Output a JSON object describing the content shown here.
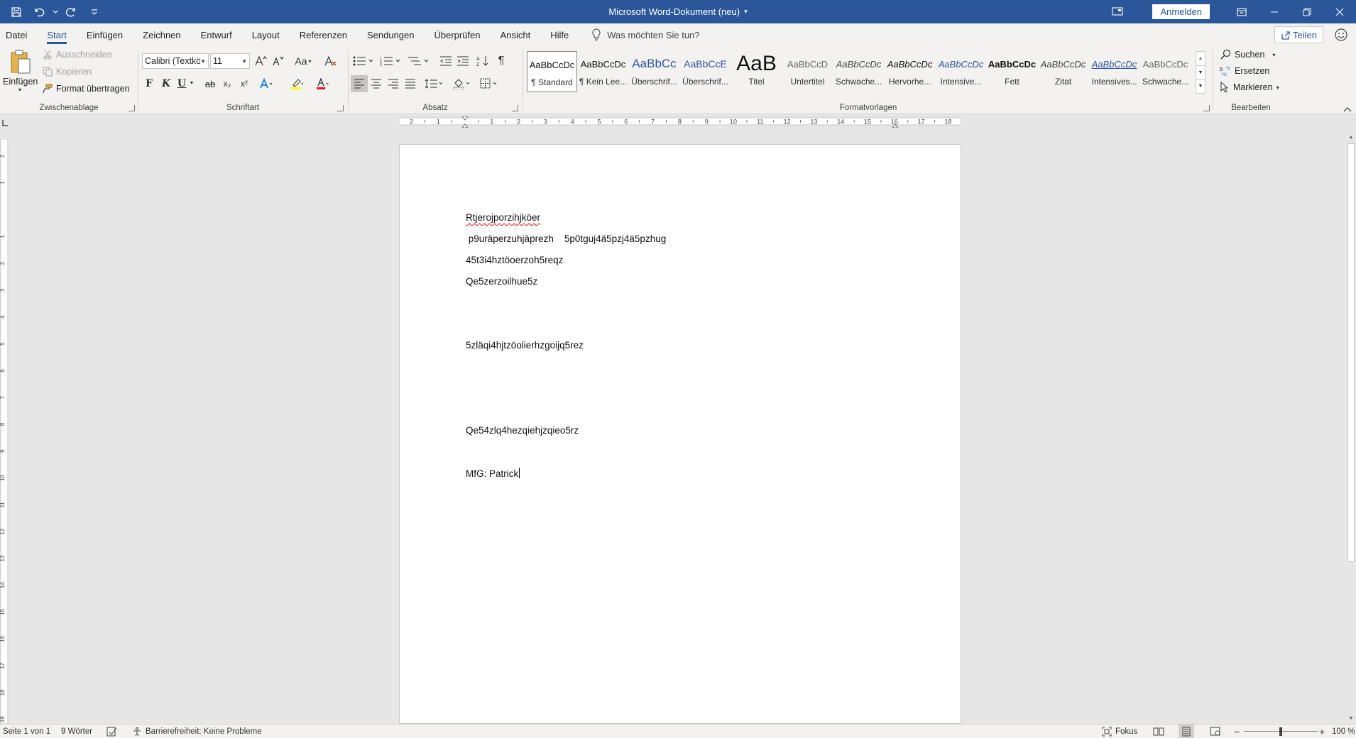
{
  "window": {
    "title": "Microsoft Word-Dokument (neu)",
    "signin_label": "Anmelden"
  },
  "tabs": {
    "items": [
      "Datei",
      "Start",
      "Einfügen",
      "Zeichnen",
      "Entwurf",
      "Layout",
      "Referenzen",
      "Sendungen",
      "Überprüfen",
      "Ansicht",
      "Hilfe"
    ],
    "active": "Start",
    "tellme_placeholder": "Was möchten Sie tun?",
    "share_label": "Teilen"
  },
  "clipboard": {
    "group_label": "Zwischenablage",
    "paste_label": "Einfügen",
    "cut_label": "Ausschneiden",
    "copy_label": "Kopieren",
    "format_painter_label": "Format übertragen"
  },
  "font": {
    "group_label": "Schriftart",
    "font_name": "Calibri (Textkö",
    "font_size": "11",
    "bold": "F",
    "italic": "K",
    "underline": "U",
    "strike": "ab",
    "subscript": "x₂",
    "superscript": "x²",
    "change_case": "Aa",
    "grow": "A^",
    "shrink": "Aˇ"
  },
  "paragraph": {
    "group_label": "Absatz"
  },
  "styles": {
    "group_label": "Formatvorlagen",
    "items": [
      {
        "preview": "AaBbCcDc",
        "name": "¶ Standard"
      },
      {
        "preview": "AaBbCcDc",
        "name": "¶ Kein Lee..."
      },
      {
        "preview": "AaBbCc",
        "name": "Überschrif..."
      },
      {
        "preview": "AaBbCcE",
        "name": "Überschrif..."
      },
      {
        "preview": "AaB",
        "name": "Titel"
      },
      {
        "preview": "AaBbCcD",
        "name": "Untertitel"
      },
      {
        "preview": "AaBbCcDc",
        "name": "Schwache..."
      },
      {
        "preview": "AaBbCcDc",
        "name": "Hervorhe..."
      },
      {
        "preview": "AaBbCcDc",
        "name": "Intensive..."
      },
      {
        "preview": "AaBbCcDc",
        "name": "Fett"
      },
      {
        "preview": "AaBbCcDc",
        "name": "Zitat"
      },
      {
        "preview": "AaBbCcDc",
        "name": "Intensives..."
      },
      {
        "preview": "AaBbCcDc",
        "name": "Schwache..."
      }
    ],
    "selected_index": 0
  },
  "editing": {
    "group_label": "Bearbeiten",
    "find_label": "Suchen",
    "replace_label": "Ersetzen",
    "select_label": "Markieren"
  },
  "ruler": {
    "h_labels": [
      "2",
      "1",
      "",
      "1",
      "2",
      "3",
      "4",
      "5",
      "6",
      "7",
      "8",
      "9",
      "10",
      "11",
      "12",
      "13",
      "14",
      "15",
      "16",
      "17",
      "18"
    ],
    "v_labels": [
      "2",
      "1",
      "",
      "1",
      "2",
      "3",
      "4",
      "5",
      "6",
      "7",
      "8",
      "9",
      "10",
      "11",
      "12",
      "13",
      "14",
      "15",
      "16",
      "17",
      "18",
      "19"
    ]
  },
  "document": {
    "paragraphs": [
      "Rtjerojporzihjköer",
      " p9uräperzuhjäprezh    5p0tguj4ä5pzj4ä5pzhug",
      "45t3i4hztöoerzoh5reqz",
      "Qe5zerzoilhue5z",
      "5zläqi4hjtzöolierhzgoijq5rez",
      "Qe54zlq4hezqiehjzqieo5rz",
      "MfG: Patrick"
    ]
  },
  "status": {
    "page": "Seite 1 von 1",
    "words": "9 Wörter",
    "accessibility": "Barrierefreiheit: Keine Probleme",
    "focus": "Fokus",
    "zoom": "100 %"
  }
}
